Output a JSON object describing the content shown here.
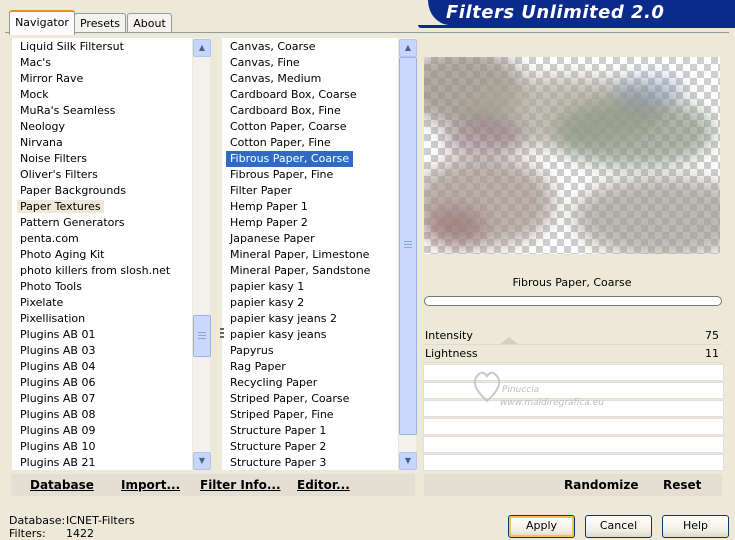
{
  "tabs": [
    {
      "label": "Navigator",
      "active": true
    },
    {
      "label": "Presets",
      "active": false
    },
    {
      "label": "About",
      "active": false
    }
  ],
  "banner": {
    "title": "Filters Unlimited 2.0",
    "color": "#0a2a8c"
  },
  "categories": {
    "items": [
      "Liquid Silk Filtersut",
      "Mac's",
      "Mirror Rave",
      "Mock",
      "MuRa's Seamless",
      "Neology",
      "Nirvana",
      "Noise Filters",
      "Oliver's Filters",
      "Paper Backgrounds",
      "Paper Textures",
      "Pattern Generators",
      "penta.com",
      "Photo Aging Kit",
      "photo killers from slosh.net",
      "Photo Tools",
      "Pixelate",
      "Pixellisation",
      "Plugins AB 01",
      "Plugins AB 03",
      "Plugins AB 04",
      "Plugins AB 06",
      "Plugins AB 07",
      "Plugins AB 08",
      "Plugins AB 09",
      "Plugins AB 10",
      "Plugins AB 21"
    ],
    "selected": "Paper Textures"
  },
  "filters": {
    "items": [
      "Canvas, Coarse",
      "Canvas, Fine",
      "Canvas, Medium",
      "Cardboard Box, Coarse",
      "Cardboard Box, Fine",
      "Cotton Paper, Coarse",
      "Cotton Paper, Fine",
      "Fibrous Paper, Coarse",
      "Fibrous Paper, Fine",
      "Filter Paper",
      "Hemp Paper 1",
      "Hemp Paper 2",
      "Japanese Paper",
      "Mineral Paper, Limestone",
      "Mineral Paper, Sandstone",
      "papier kasy 1",
      "papier kasy 2",
      "papier kasy jeans 2",
      "papier kasy jeans",
      "Papyrus",
      "Rag Paper",
      "Recycling Paper",
      "Striped Paper, Coarse",
      "Striped Paper, Fine",
      "Structure Paper 1",
      "Structure Paper 2",
      "Structure Paper 3"
    ],
    "selected": "Fibrous Paper, Coarse",
    "selected_color": "#316ac5"
  },
  "preview": {
    "caption": "Fibrous Paper, Coarse"
  },
  "sliders": [
    {
      "label": "Intensity",
      "value": "75"
    },
    {
      "label": "Lightness",
      "value": "11"
    }
  ],
  "watermark": {
    "line1": "Pinuccia",
    "line2": "www.maldiregrafica.eu"
  },
  "toolbar": {
    "database": "Database",
    "import": "Import...",
    "filter_info": "Filter Info...",
    "editor": "Editor...",
    "randomize": "Randomize",
    "reset": "Reset"
  },
  "status": {
    "database_label": "Database:",
    "database_value": "ICNET-Filters",
    "filters_label": "Filters:",
    "filters_value": "1422"
  },
  "buttons": {
    "apply": "Apply",
    "cancel": "Cancel",
    "help": "Help"
  }
}
